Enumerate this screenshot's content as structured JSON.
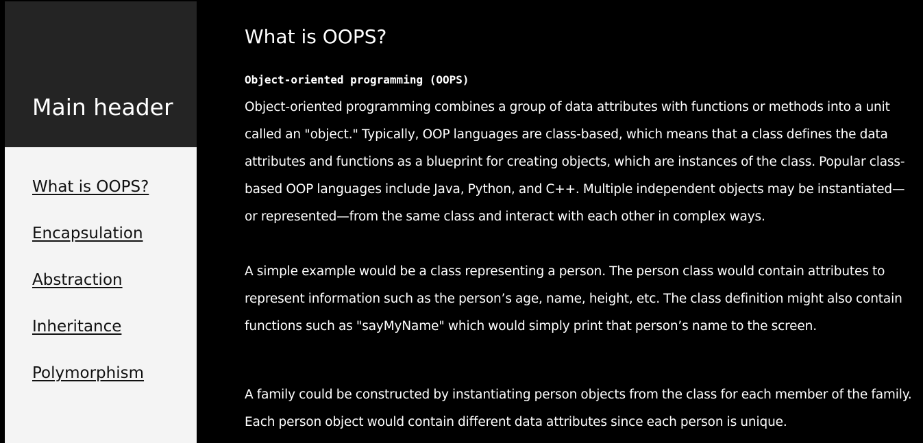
{
  "sidebar": {
    "header": "Main header",
    "nav": [
      {
        "label": "What is OOPS?"
      },
      {
        "label": "Encapsulation"
      },
      {
        "label": "Abstraction"
      },
      {
        "label": "Inheritance"
      },
      {
        "label": "Polymorphism"
      }
    ]
  },
  "main": {
    "title": "What is OOPS?",
    "subtitle": "Object-oriented programming (OOPS)",
    "paragraphs": [
      "Object-oriented programming combines a group of data attributes with functions or methods into a unit called an \"object.\" Typically, OOP languages are class-based, which means that a class defines the data attributes and functions as a blueprint for creating objects, which are instances of the class. Popular class-based OOP languages include Java, Python, and C++. Multiple independent objects may be instantiated—or represented—from the same class and interact with each other in complex ways.",
      "A simple example would be a class representing a person. The person class would contain attributes to represent information such as the person’s age, name, height, etc. The class definition might also contain functions such as \"sayMyName\" which would simply print that person’s name to the screen.",
      "A family could be constructed by instantiating person objects from the class for each member of the family. Each person object would contain different data attributes since each person is unique."
    ]
  },
  "colors": {
    "page_background": "#000000",
    "sidebar_background": "#f4f4f4",
    "sidebar_header_background": "#242424",
    "main_text": "#ffffff",
    "nav_link": "#111111"
  }
}
